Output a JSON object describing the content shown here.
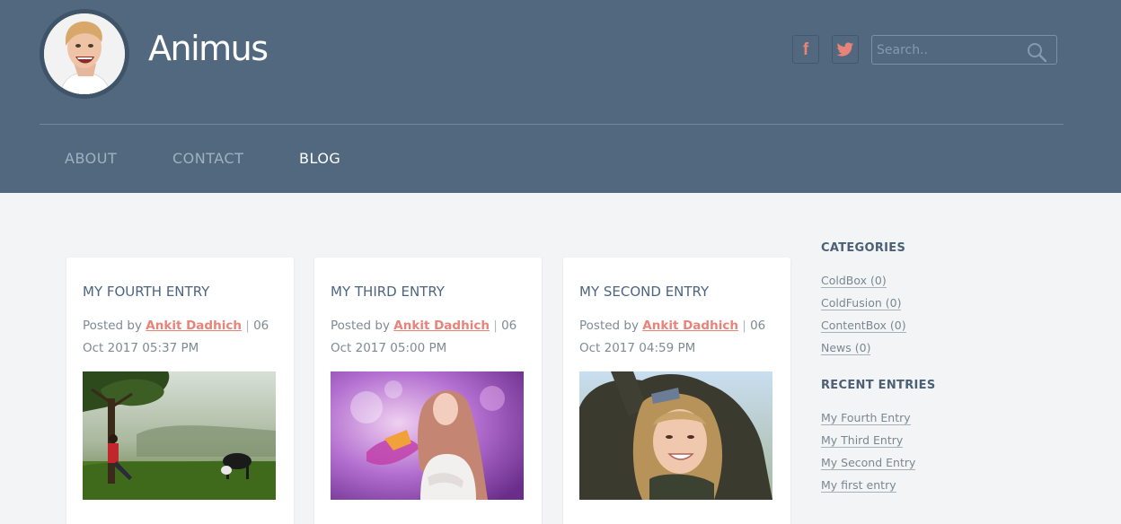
{
  "site": {
    "title": "Animus"
  },
  "header": {
    "search_placeholder": "Search..",
    "social": [
      {
        "name": "facebook",
        "glyph": "f",
        "icon": "facebook-icon"
      },
      {
        "name": "twitter",
        "icon": "twitter-icon"
      }
    ]
  },
  "nav": {
    "items": [
      {
        "label": "ABOUT",
        "active": false
      },
      {
        "label": "CONTACT",
        "active": false
      },
      {
        "label": "BLOG",
        "active": true
      }
    ]
  },
  "posts": [
    {
      "title": "MY FOURTH ENTRY",
      "posted_by": "Posted by",
      "author": "Ankit Dadhich",
      "separator": "|",
      "date": "06 Oct 2017 05:37 PM",
      "image": "misty-forest-scene"
    },
    {
      "title": "MY THIRD ENTRY",
      "posted_by": "Posted by",
      "author": "Ankit Dadhich",
      "separator": "|",
      "date": "06 Oct 2017 05:00 PM",
      "image": "woman-purple-background"
    },
    {
      "title": "MY SECOND ENTRY",
      "posted_by": "Posted by",
      "author": "Ankit Dadhich",
      "separator": "|",
      "date": "06 Oct 2017 04:59 PM",
      "image": "woman-fur-hood"
    }
  ],
  "sidebar": {
    "categories_heading": "CATEGORIES",
    "categories": [
      "ColdBox (0)",
      "ColdFusion (0)",
      "ContentBox (0)",
      "News (0)"
    ],
    "recent_heading": "RECENT ENTRIES",
    "recent": [
      "My Fourth Entry",
      "My Third Entry",
      "My Second Entry",
      "My first entry"
    ]
  },
  "colors": {
    "header_bg": "#51687f",
    "accent": "#e8837a",
    "page_bg": "#f3f4f6"
  }
}
